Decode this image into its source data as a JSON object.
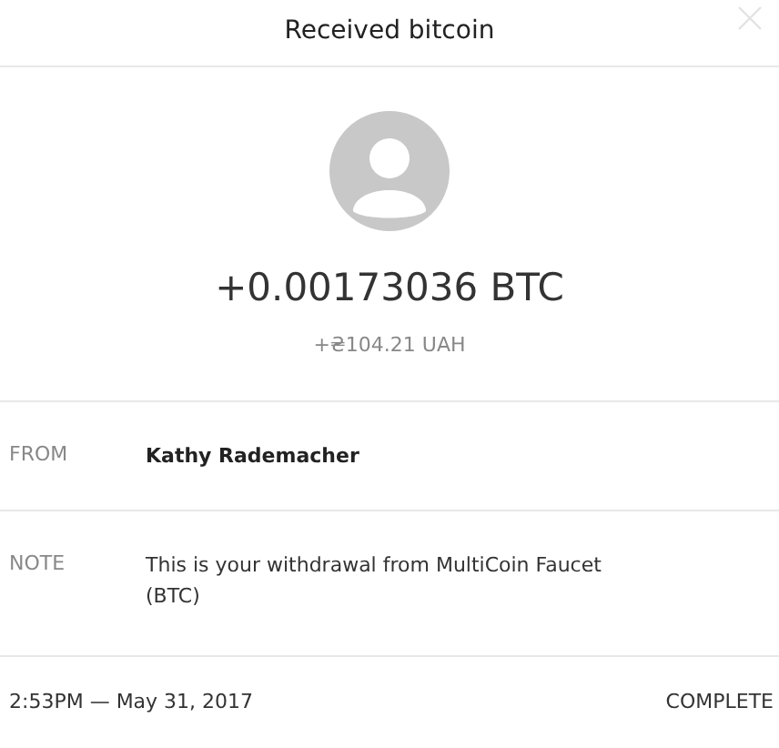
{
  "title": "Received bitcoin",
  "amount": "+0.00173036 BTC",
  "fiat_amount": "+₴104.21 UAH",
  "details": [
    {
      "label": "FROM",
      "value": "Kathy Rademacher",
      "bold": true
    },
    {
      "label": "NOTE",
      "value": "This is your withdrawal from MultiCoin Faucet (BTC)",
      "bold": false
    }
  ],
  "footer": {
    "timestamp": "2:53PM — May 31, 2017",
    "status": "COMPLETE"
  }
}
